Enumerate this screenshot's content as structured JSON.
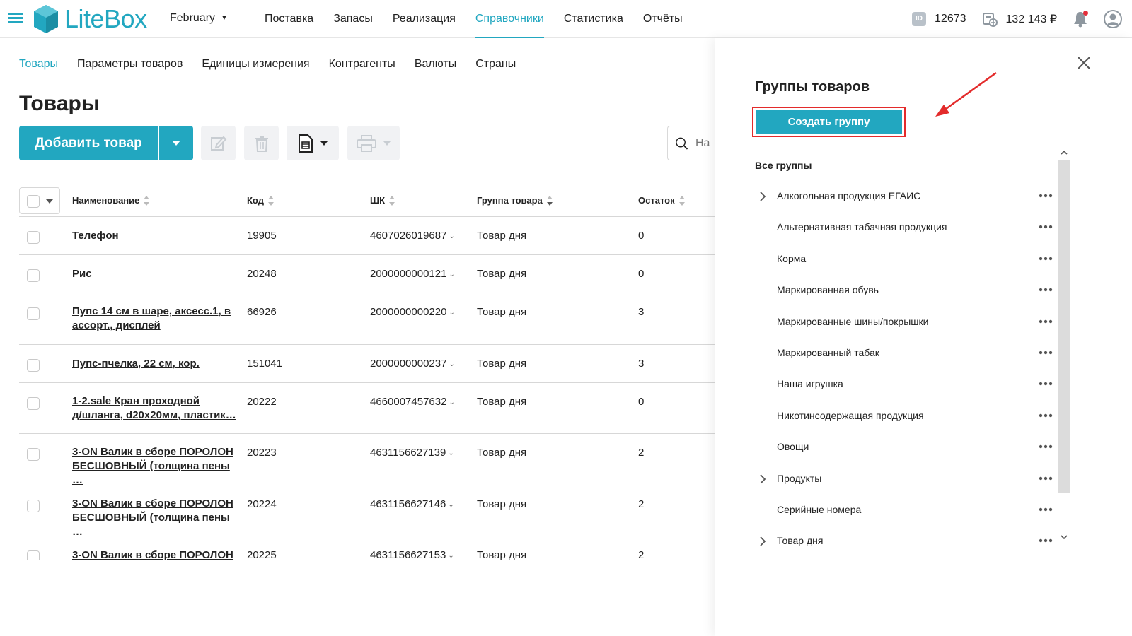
{
  "app": {
    "logo_text": "LiteBox",
    "month": "February"
  },
  "nav": {
    "items": [
      "Поставка",
      "Запасы",
      "Реализация",
      "Справочники",
      "Статистика",
      "Отчёты"
    ],
    "active": "Справочники"
  },
  "topbar": {
    "id_badge": "ID",
    "id_value": "12673",
    "balance": "132 143 ₽"
  },
  "subtabs": [
    "Товары",
    "Параметры товаров",
    "Единицы измерения",
    "Контрагенты",
    "Валюты",
    "Страны"
  ],
  "page": {
    "title": "Товары"
  },
  "toolbar": {
    "add_label": "Добавить товар",
    "search_placeholder": "На"
  },
  "table": {
    "headers": {
      "name": "Наименование",
      "code": "Код",
      "barcode": "ШК",
      "group": "Группа товара",
      "stock": "Остаток"
    },
    "rows": [
      {
        "name": "Телефон",
        "name2": "",
        "code": "19905",
        "barcode": "4607026019687",
        "group": "Товар дня",
        "stock": "0"
      },
      {
        "name": "Рис",
        "name2": "",
        "code": "20248",
        "barcode": "2000000000121",
        "group": "Товар дня",
        "stock": "0"
      },
      {
        "name": "Пупс 14 см в шаре, аксесс.1, в",
        "name2": "ассорт., дисплей",
        "code": "66926",
        "barcode": "2000000000220",
        "group": "Товар дня",
        "stock": "3"
      },
      {
        "name": "Пупс-пчелка, 22 см, кор.",
        "name2": "",
        "code": "151041",
        "barcode": "2000000000237",
        "group": "Товар дня",
        "stock": "3"
      },
      {
        "name": "1-2.sale Кран проходной",
        "name2": "д/шланга, d20x20мм, пластик…",
        "code": "20222",
        "barcode": "4660007457632",
        "group": "Товар дня",
        "stock": "0"
      },
      {
        "name": "3-ON Валик в сборе ПОРОЛОН",
        "name2": "БЕСШОВНЫЙ (толщина пены …",
        "code": "20223",
        "barcode": "4631156627139",
        "group": "Товар дня",
        "stock": "2"
      },
      {
        "name": "3-ON Валик в сборе ПОРОЛОН",
        "name2": "БЕСШОВНЫЙ (толщина пены …",
        "code": "20224",
        "barcode": "4631156627146",
        "group": "Товар дня",
        "stock": "2"
      },
      {
        "name": "3-ON Валик в сборе ПОРОЛОН",
        "name2": "",
        "code": "20225",
        "barcode": "4631156627153",
        "group": "Товар дня",
        "stock": "2"
      }
    ]
  },
  "panel": {
    "title": "Группы товаров",
    "create_label": "Создать группу",
    "all_groups": "Все группы",
    "groups": [
      {
        "label": "Алкогольная продукция ЕГАИС",
        "expandable": true
      },
      {
        "label": "Альтернативная табачная продукция",
        "expandable": false
      },
      {
        "label": "Корма",
        "expandable": false
      },
      {
        "label": "Маркированная обувь",
        "expandable": false
      },
      {
        "label": "Маркированные шины/покрышки",
        "expandable": false
      },
      {
        "label": "Маркированный табак",
        "expandable": false
      },
      {
        "label": "Наша игрушка",
        "expandable": false
      },
      {
        "label": "Никотинсодержащая продукция",
        "expandable": false
      },
      {
        "label": "Овощи",
        "expandable": false
      },
      {
        "label": "Продукты",
        "expandable": true
      },
      {
        "label": "Серийные номера",
        "expandable": false
      },
      {
        "label": "Товар дня",
        "expandable": true
      }
    ]
  },
  "colors": {
    "accent": "#22a7c0",
    "highlight": "#e32b2b",
    "notification": "#e52d3a"
  }
}
